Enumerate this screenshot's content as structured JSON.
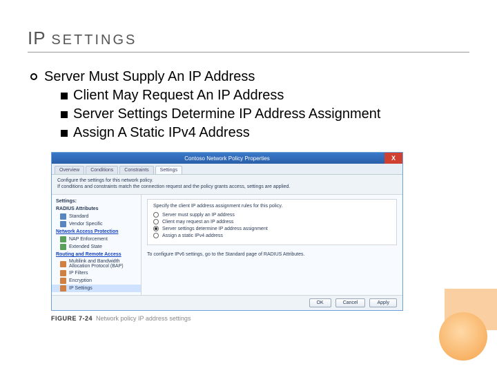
{
  "title": {
    "big": "IP",
    "small": "SETTINGS"
  },
  "bullets": {
    "main": "Server Must Supply An IP Address",
    "subs": [
      "Client May Request An IP Address",
      "Server Settings Determine IP Address Assignment",
      "Assign A Static IPv4 Address"
    ]
  },
  "dialog": {
    "title": "Contoso Network Policy Properties",
    "close": "X",
    "tabs": [
      "Overview",
      "Conditions",
      "Constraints",
      "Settings"
    ],
    "active_tab": 3,
    "desc1": "Configure the settings for this network policy.",
    "desc2": "If conditions and constraints match the connection request and the policy grants access, settings are applied.",
    "settings_label": "Settings:",
    "groups": [
      {
        "name": "RADIUS Attributes",
        "items": [
          {
            "label": "Standard",
            "link": false
          },
          {
            "label": "Vendor Specific",
            "link": false
          }
        ]
      },
      {
        "name": "Network Access Protection",
        "link": true,
        "items": [
          {
            "label": "NAP Enforcement",
            "link": false
          },
          {
            "label": "Extended State",
            "link": false
          }
        ]
      },
      {
        "name": "Routing and Remote Access",
        "link": true,
        "items": [
          {
            "label": "Multilink and Bandwidth Allocation Protocol (BAP)",
            "link": false
          },
          {
            "label": "IP Filters",
            "link": false
          },
          {
            "label": "Encryption",
            "link": false
          },
          {
            "label": "IP Settings",
            "link": false,
            "selected": true
          }
        ]
      }
    ],
    "pane": {
      "lead": "Specify the client IP address assignment rules for this policy.",
      "radios": [
        {
          "label": "Server must supply an IP address",
          "on": false
        },
        {
          "label": "Client may request an IP address",
          "on": false
        },
        {
          "label": "Server settings determine IP address assignment",
          "on": true
        },
        {
          "label": "Assign a static IPv4 address",
          "on": false
        }
      ],
      "note": "To configure IPv6 settings, go to the Standard page of RADIUS Attributes."
    },
    "buttons": [
      "OK",
      "Cancel",
      "Apply"
    ]
  },
  "caption": {
    "fig": "FIGURE 7-24",
    "text": "Network policy IP address settings"
  }
}
